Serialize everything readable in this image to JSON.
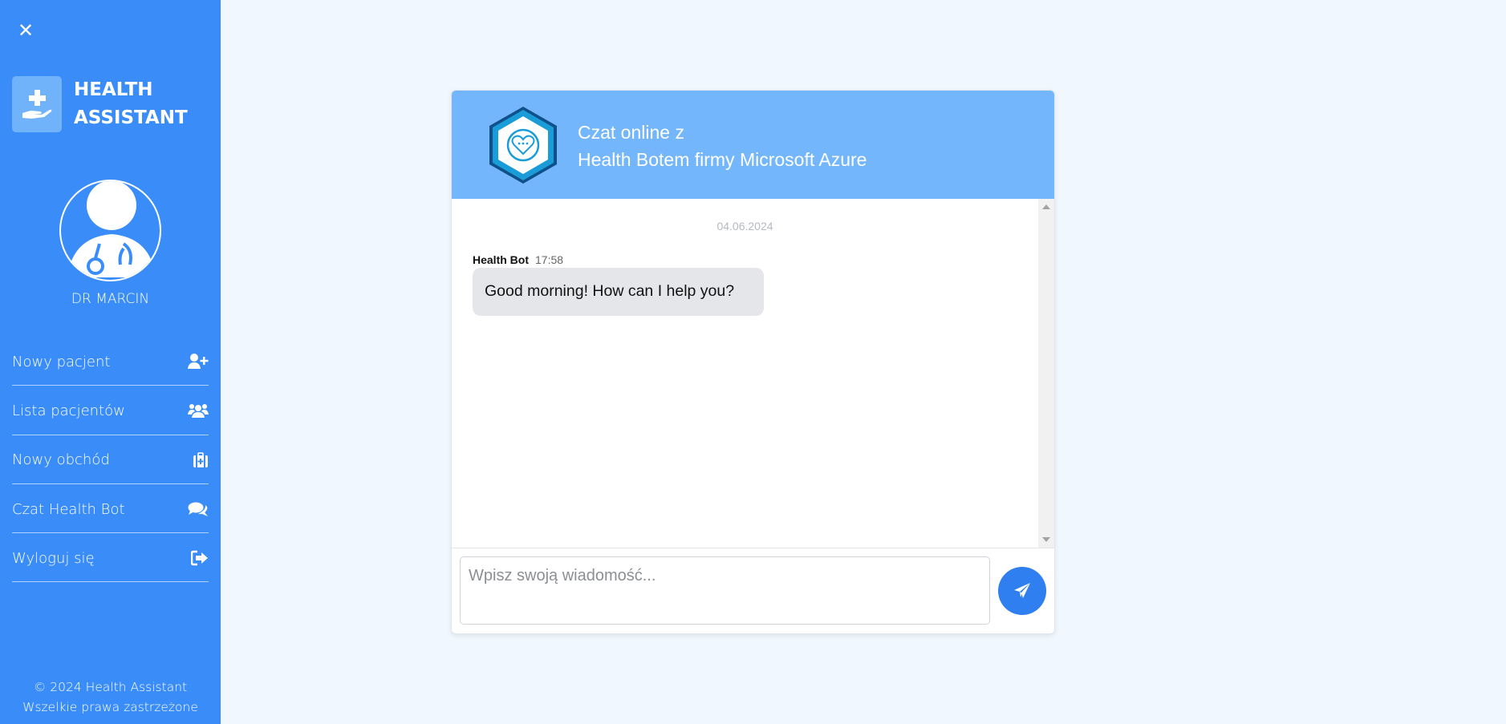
{
  "sidebar": {
    "close_icon": "close-icon",
    "brand_name": "HEALTH ASSISTANT",
    "brand_icon": "hand-holding-medical-icon",
    "doctor_name": "DR MARCIN",
    "menu": [
      {
        "label": "Nowy pacjent",
        "icon": "user-plus-icon"
      },
      {
        "label": "Lista pacjentów",
        "icon": "users-icon"
      },
      {
        "label": "Nowy obchód",
        "icon": "medical-kit-icon"
      },
      {
        "label": "Czat Health Bot",
        "icon": "comments-icon"
      },
      {
        "label": "Wyloguj się",
        "icon": "sign-out-icon"
      }
    ],
    "footer_line1": "© 2024 Health Assistant",
    "footer_line2": "Wszelkie prawa zastrzeżone"
  },
  "chat": {
    "title_line1": "Czat online z",
    "title_line2": "Health Botem firmy Microsoft Azure",
    "date": "04.06.2024",
    "messages": [
      {
        "sender": "Health Bot",
        "time": "17:58",
        "text": "Good morning! How can I help you?"
      }
    ],
    "input_placeholder": "Wpisz swoją wiadomość...",
    "send_icon": "paper-plane-icon"
  },
  "colors": {
    "sidebar_bg": "#3a8df8",
    "header_bg": "#73b6fb",
    "page_bg": "#f0f7fe",
    "send_button": "#2f7ff0"
  }
}
